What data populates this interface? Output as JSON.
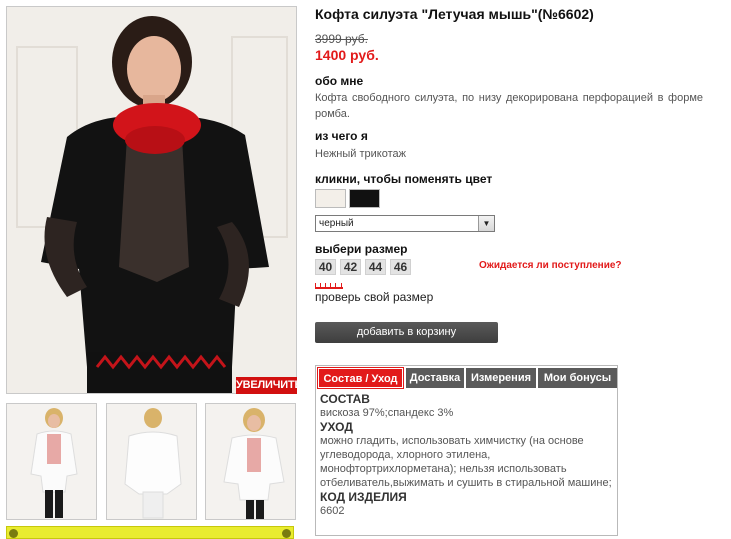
{
  "product": {
    "title": "Кофта силуэта \"Летучая мышь\"(№6602)",
    "old_price": "3999 руб.",
    "new_price": "1400 руб."
  },
  "about": {
    "heading": "обо мне",
    "text": "Кофта свободного силуэта, по низу декорирована перфорацией в форме ромба."
  },
  "material": {
    "heading": "из чего я",
    "text": "Нежный трикотаж"
  },
  "color": {
    "heading": "кликни, чтобы поменять цвет",
    "swatches": [
      {
        "name": "white",
        "hex": "#f3efe9"
      },
      {
        "name": "black",
        "hex": "#111111"
      }
    ],
    "selected": "черный"
  },
  "size": {
    "heading": "выбери размер",
    "options": [
      "40",
      "42",
      "44",
      "46"
    ],
    "await_link": "Ожидается ли поступление?",
    "check_link": "проверь свой размер"
  },
  "cart": {
    "button": "добавить в корзину"
  },
  "gallery": {
    "zoom_label": "УВЕЛИЧИТЬ"
  },
  "tabs": {
    "items": [
      "Состав / Уход",
      "Доставка",
      "Измерения",
      "Мои бонусы"
    ],
    "active": "Состав / Уход",
    "content": {
      "composition_heading": "СОСТАВ",
      "composition": "вискоза 97%;спандекс 3%",
      "care_heading": "УХОД",
      "care": "можно гладить, использовать химчистку (на основе углеводорода, хлорного этилена, монофтортрихлорметана); нельзя использовать отбеливатель,выжимать и сушить в стиральной машине;",
      "code_heading": "КОД ИЗДЕЛИЯ",
      "code": "6602"
    }
  },
  "colors": {
    "accent": "#e21a1a",
    "button": "#4a4a4a",
    "tab": "#5a5a5a"
  }
}
